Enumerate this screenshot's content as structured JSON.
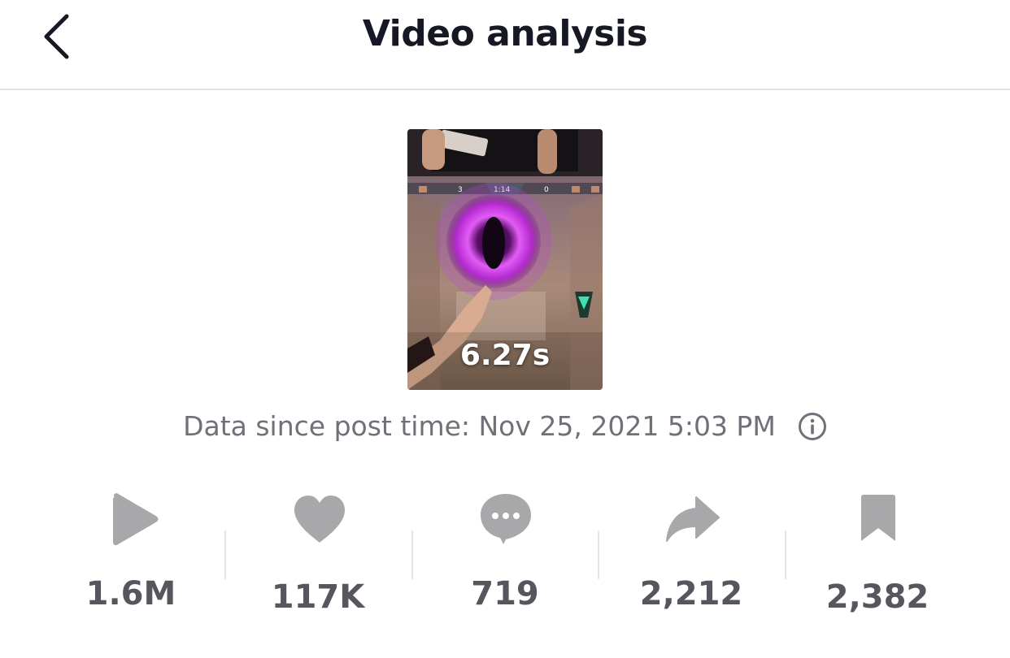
{
  "header": {
    "title": "Video analysis",
    "back_icon": "chevron-left-icon"
  },
  "video": {
    "duration": "6.27s",
    "thumbnail_scoreboard": {
      "left_score": "3",
      "timer": "1:14",
      "right_score": "0"
    }
  },
  "data_since": {
    "text": "Data since post time: Nov 25, 2021 5:03 PM",
    "info_icon": "info-icon"
  },
  "stats": [
    {
      "icon": "play-icon",
      "value": "1.6M"
    },
    {
      "icon": "heart-icon",
      "value": "117K"
    },
    {
      "icon": "comment-icon",
      "value": "719"
    },
    {
      "icon": "share-icon",
      "value": "2,212"
    },
    {
      "icon": "bookmark-icon",
      "value": "2,382"
    }
  ],
  "colors": {
    "title": "#161823",
    "secondary_text": "#6f7078",
    "stat_value": "#56575e",
    "icon_gray": "#a8a8ab",
    "thumbnail_accent": "#d13cf0"
  }
}
